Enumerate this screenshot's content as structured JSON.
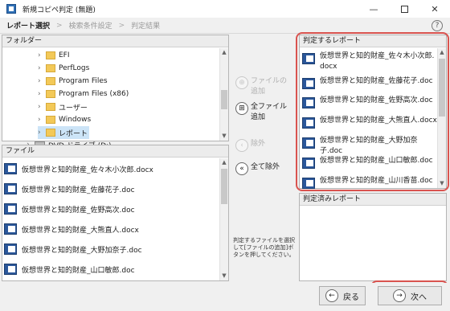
{
  "window": {
    "title": "新規コピペ判定 (無題)"
  },
  "steps": [
    "レポート選択",
    "検索条件設定",
    "判定結果"
  ],
  "step_separator": ">",
  "help": "?",
  "folders": {
    "header": "フォルダー",
    "items": [
      {
        "label": "EFI"
      },
      {
        "label": "PerfLogs"
      },
      {
        "label": "Program Files"
      },
      {
        "label": "Program Files (x86)"
      },
      {
        "label": "ユーザー"
      },
      {
        "label": "Windows"
      },
      {
        "label": "レポート"
      },
      {
        "label": "DVD ドライブ (D:)"
      }
    ]
  },
  "files": {
    "header": "ファイル",
    "items": [
      "仮想世界と知的財産_佐々木小次郎.docx",
      "仮想世界と知的財産_佐藤花子.doc",
      "仮想世界と知的財産_佐野高次.doc",
      "仮想世界と知的財産_大熊直人.docx",
      "仮想世界と知的財産_大野加奈子.doc",
      "仮想世界と知的財産_山口敏郎.doc"
    ]
  },
  "actions": {
    "add_selected_line1": "ファイルの",
    "add_selected_line2": "追加",
    "add_all_line1": "全ファイル",
    "add_all_line2": "追加",
    "remove": "除外",
    "remove_all": "全て除外",
    "note": "判定するファイルを選択して[ファイルの追加]ボタンを押してください。"
  },
  "reports": {
    "header": "判定するレポート",
    "items": [
      {
        "line1": "仮想世界と知的財産_佐々木小次郎.",
        "line2": "docx"
      },
      {
        "line1": "仮想世界と知的財産_佐藤花子.doc",
        "line2": ""
      },
      {
        "line1": "仮想世界と知的財産_佐野高次.doc",
        "line2": ""
      },
      {
        "line1": "仮想世界と知的財産_大熊直人.docx",
        "line2": ""
      },
      {
        "line1": "仮想世界と知的財産_大野加奈子.doc",
        "line2": ""
      },
      {
        "line1": "仮想世界と知的財産_山口敏郎.doc",
        "line2": ""
      },
      {
        "line1": "仮想世界と知的財産_山川香苗.doc",
        "line2": ""
      }
    ]
  },
  "done": {
    "header": "判定済みレポート"
  },
  "nav": {
    "back": "戻る",
    "next": "次へ"
  },
  "colors": {
    "highlight": "#d9534f",
    "selection": "#cce4f7"
  }
}
